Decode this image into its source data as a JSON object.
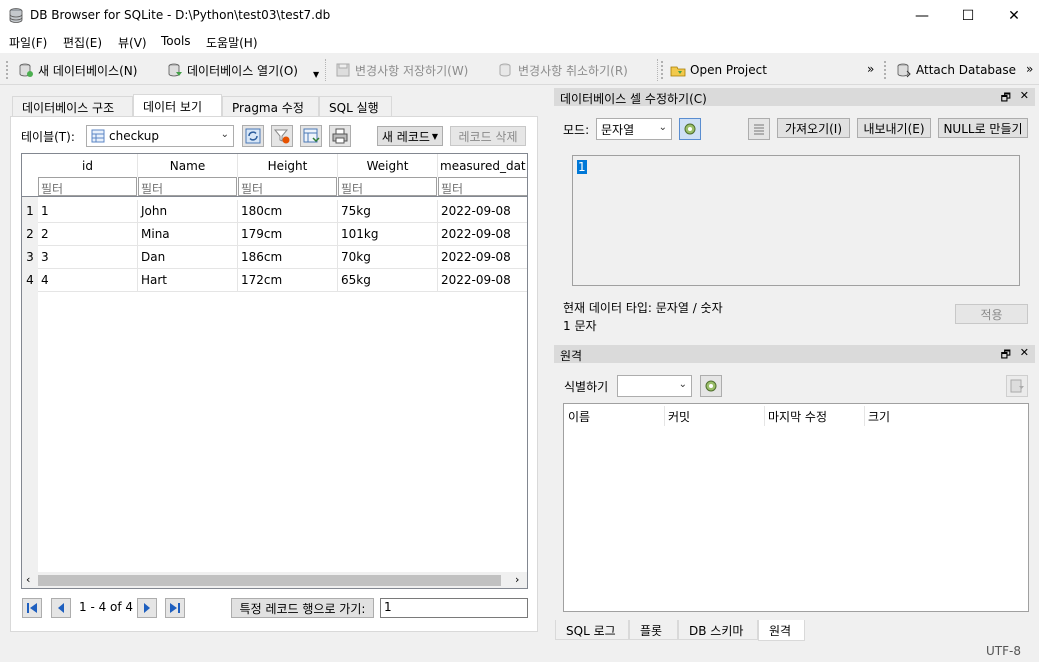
{
  "window": {
    "title": "DB Browser for SQLite - D:\\Python\\test03\\test7.db",
    "minimize_glyph": "—",
    "maximize_glyph": "☐",
    "close_glyph": "✕"
  },
  "menu": [
    "파일(F)",
    "편집(E)",
    "뷰(V)",
    "Tools",
    "도움말(H)"
  ],
  "toolbar": {
    "new_db": "새 데이터베이스(N)",
    "open_db": "데이터베이스 열기(O)",
    "write_changes": "변경사항 저장하기(W)",
    "revert_changes": "변경사항 취소하기(R)",
    "open_project": "Open Project",
    "attach_db": "Attach Database",
    "overflow": "»"
  },
  "tabs": [
    "데이터베이스 구조",
    "데이터 보기",
    "Pragma 수정",
    "SQL 실행"
  ],
  "browse": {
    "table_label": "테이블(T):",
    "table_value": "checkup",
    "new_record": "새 레코드",
    "delete_record": "레코드 삭제",
    "columns": [
      "id",
      "Name",
      "Height",
      "Weight",
      "measured_dat"
    ],
    "filter_placeholder": "필터",
    "rows": [
      {
        "num": "1",
        "cells": [
          "1",
          "John",
          "180cm",
          "75kg",
          "2022-09-08"
        ]
      },
      {
        "num": "2",
        "cells": [
          "2",
          "Mina",
          "179cm",
          "101kg",
          "2022-09-08"
        ]
      },
      {
        "num": "3",
        "cells": [
          "3",
          "Dan",
          "186cm",
          "70kg",
          "2022-09-08"
        ]
      },
      {
        "num": "4",
        "cells": [
          "4",
          "Hart",
          "172cm",
          "65kg",
          "2022-09-08"
        ]
      }
    ],
    "record_count": "1 - 4 of 4",
    "goto_label": "특정 레코드 행으로 가기:",
    "goto_value": "1"
  },
  "edit_cell": {
    "title": "데이터베이스 셀 수정하기(C)",
    "mode_label": "모드:",
    "mode_value": "문자열",
    "import_btn": "가져오기(I)",
    "export_btn": "내보내기(E)",
    "null_btn": "NULL로 만들기",
    "editor_value": "1",
    "type_info": "현재 데이터 타입: 문자열 / 숫자",
    "size_info": "1 문자",
    "apply_btn": "적용"
  },
  "remote": {
    "title": "원격",
    "identity_label": "식별하기",
    "columns": [
      "이름",
      "커밋",
      "마지막 수정",
      "크기"
    ]
  },
  "bottom_tabs": [
    "SQL 로그",
    "플롯",
    "DB 스키마",
    "원격"
  ],
  "statusbar": {
    "encoding": "UTF-8"
  },
  "colors": {
    "accent": "#0078d7",
    "panel_title": "#dadada"
  }
}
